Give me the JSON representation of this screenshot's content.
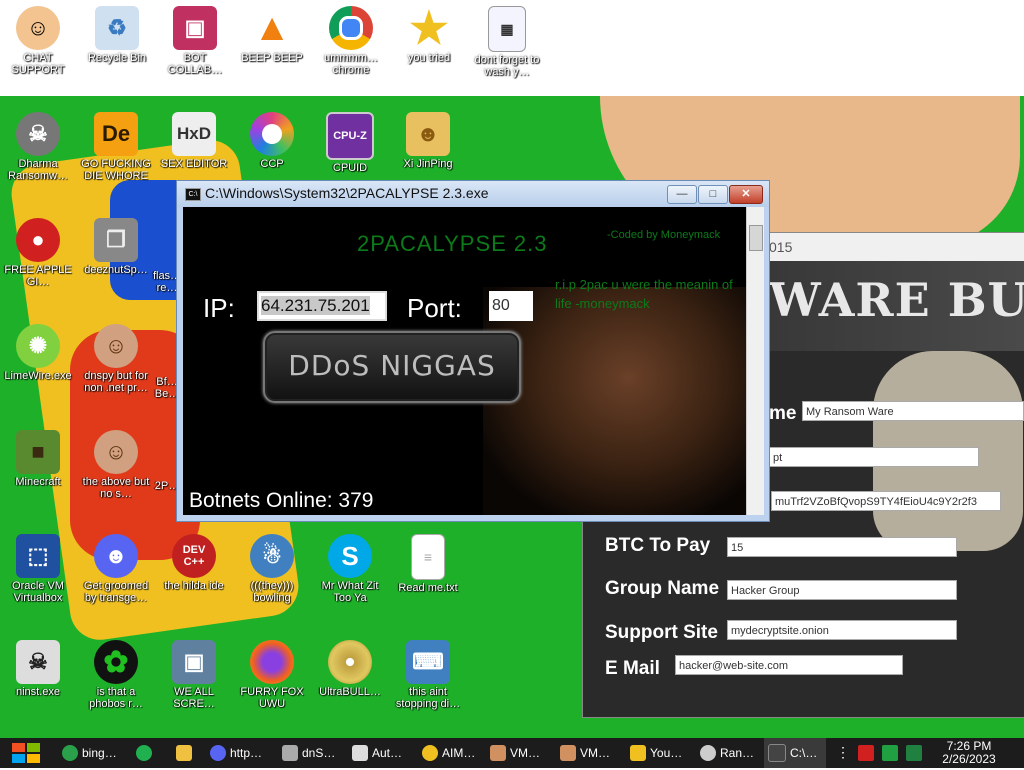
{
  "desktop": {
    "top_icons": [
      {
        "label": "CHAT SUPPORT",
        "icon": "doctor-icon",
        "color": "#f4c490"
      },
      {
        "label": "Recycle Bin",
        "icon": "recycle-bin-icon",
        "color": "#cfe0f0"
      },
      {
        "label": "BOT COLLAB…",
        "icon": "monitor-icon",
        "color": "#c03060"
      },
      {
        "label": "BEEP BEEP",
        "icon": "vlc-icon",
        "color": "#f08010"
      },
      {
        "label": "ummmm… chrome",
        "icon": "chrome-icon",
        "color": "#2aa04a"
      },
      {
        "label": "you tried",
        "icon": "star-icon",
        "color": "#f0c020"
      },
      {
        "label": "dont forget to wash y…",
        "icon": "calendar-icon",
        "color": "#e8e8ff"
      }
    ],
    "row2_icons": [
      {
        "label": "Dharma Ransomw…",
        "icon": "skull-icon",
        "color": "#888"
      },
      {
        "label": "GO FUCKING DIE WHORE",
        "icon": "de-icon",
        "color": "#f4a010",
        "text": "De"
      },
      {
        "label": "SEX EDITOR",
        "icon": "hxd-icon",
        "color": "#eeeeee",
        "text": "HxD"
      },
      {
        "label": "CCP",
        "icon": "ccp-icon",
        "color": "#e04080"
      },
      {
        "label": "CPUID",
        "icon": "cpuz-icon",
        "color": "#7030a0",
        "text": "CPU-Z"
      },
      {
        "label": "Xi JinPing",
        "icon": "folder-person-icon",
        "color": "#e8c060"
      }
    ],
    "left_icons": [
      {
        "label": "FREE APPLE GI…",
        "icon": "apple-icon",
        "color": "#d02020"
      },
      {
        "label": "LimeWire.exe",
        "icon": "limewire-icon",
        "color": "#80d040"
      },
      {
        "label": "Minecraft",
        "icon": "minecraft-icon",
        "color": "#5a8a30"
      },
      {
        "label": "Oracle VM Virtualbox",
        "icon": "virtualbox-icon",
        "color": "#2050a0"
      },
      {
        "label": "ninst.exe",
        "icon": "skull-icon",
        "color": "#dddddd"
      }
    ],
    "col2_icons": [
      {
        "label": "deeznutSp…",
        "icon": "windows-stack-icon",
        "color": "#888888"
      },
      {
        "label": "dnspy but for non .net pr…",
        "icon": "portrait-icon",
        "color": "#d0a080"
      },
      {
        "label": "the above but no s…",
        "icon": "portrait-icon",
        "color": "#d0a080"
      },
      {
        "label": "Get groomed by transge…",
        "icon": "discord-icon",
        "color": "#5865f2"
      },
      {
        "label": "is that a phobos r…",
        "icon": "icq-icon",
        "color": "#20c020"
      }
    ],
    "col3_partial": [
      {
        "label": "flas… re…"
      },
      {
        "label": "Bf… Be…"
      },
      {
        "label": "2P…"
      }
    ],
    "bottom_row1": [
      {
        "label": "the hilda ide",
        "icon": "devcpp-icon",
        "color": "#c02020",
        "text": "DEV C++"
      },
      {
        "label": "(((they))) bowling",
        "icon": "bowling-icon",
        "color": "#4080c0"
      },
      {
        "label": "Mr What Zit Too Ya",
        "icon": "skype-icon",
        "color": "#00a8e8",
        "text": "S"
      },
      {
        "label": "Read me.txt",
        "icon": "text-file-icon",
        "color": "#ffffff"
      }
    ],
    "bottom_row2": [
      {
        "label": "WE ALL SCRE…",
        "icon": "computer-icon",
        "color": "#6080a0"
      },
      {
        "label": "FURRY FOX UWU",
        "icon": "firefox-icon",
        "color": "#f06020"
      },
      {
        "label": "UltraBULL…",
        "icon": "cd-icon",
        "color": "#c0a040"
      },
      {
        "label": "this aint stopping di…",
        "icon": "network-computer-icon",
        "color": "#4080c0"
      }
    ]
  },
  "ddos_window": {
    "title": "C:\\Windows\\System32\\2PACALYPSE 2.3.exe",
    "app_title": "2PACALYPSE  2.3",
    "coded_by": "-Coded by Moneymack",
    "rip_text": "r.i.p 2pac u were the meanin of life -moneymack",
    "ip_label": "IP:",
    "ip_value": "64.231.75.201",
    "port_label": "Port:",
    "port_value": "80",
    "button_label": "DDoS NIGGAS",
    "botnets": "Botnets Online: 379",
    "min_label": "—",
    "max_label": "□",
    "close_label": "✕"
  },
  "ransom_window": {
    "title_fragment": "015",
    "banner": "WARE BUILDER",
    "fields": [
      {
        "label": "me",
        "value": "My Ransom Ware"
      },
      {
        "label": "",
        "value": "pt"
      },
      {
        "label": "",
        "value": "muTrf2VZoBfQvopS9TY4fEioU4c9Y2r2f3"
      },
      {
        "label": "BTC To Pay",
        "value": "15"
      },
      {
        "label": "Group Name",
        "value": "Hacker Group"
      },
      {
        "label": "Support Site",
        "value": "mydecryptsite.onion"
      },
      {
        "label": "E Mail",
        "value": "hacker@web-site.com"
      }
    ]
  },
  "taskbar": {
    "items": [
      {
        "label": "bing…",
        "icon": "chrome-icon",
        "color": "#2aa04a"
      },
      {
        "label": "",
        "icon": "chat-icon",
        "color": "#20b050"
      },
      {
        "label": "",
        "icon": "folder-icon",
        "color": "#f0c040"
      },
      {
        "label": "http…",
        "icon": "discord-icon",
        "color": "#5865f2"
      },
      {
        "label": "dnS…",
        "icon": "window-stack-icon",
        "color": "#aaaaaa"
      },
      {
        "label": "Aut…",
        "icon": "document-icon",
        "color": "#dddddd"
      },
      {
        "label": "AIM…",
        "icon": "aim-icon",
        "color": "#f0c020"
      },
      {
        "label": "VM…",
        "icon": "person-icon",
        "color": "#d09060"
      },
      {
        "label": "VM…",
        "icon": "person-icon",
        "color": "#d09060"
      },
      {
        "label": "You…",
        "icon": "warning-icon",
        "color": "#f0c020"
      },
      {
        "label": "Ran…",
        "icon": "gear-icon",
        "color": "#cccccc"
      },
      {
        "label": "C:\\…",
        "icon": "console-icon",
        "color": "#444444"
      }
    ],
    "time": "7:26 PM",
    "date": "2/26/2023"
  }
}
